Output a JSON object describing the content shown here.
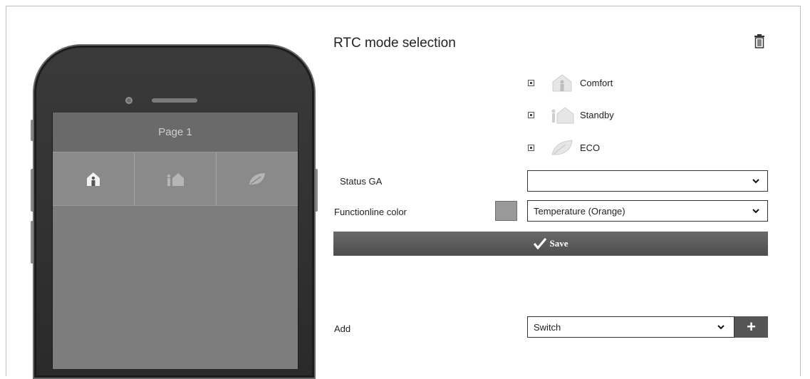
{
  "phone": {
    "page_title": "Page 1",
    "tiles": [
      {
        "icon": "comfort-house-icon"
      },
      {
        "icon": "standby-house-icon"
      },
      {
        "icon": "eco-leaf-icon"
      }
    ]
  },
  "panel": {
    "title": "RTC mode selection",
    "modes": [
      {
        "label": "Comfort",
        "icon": "comfort-house-icon"
      },
      {
        "label": "Standby",
        "icon": "standby-house-icon"
      },
      {
        "label": "ECO",
        "icon": "eco-leaf-icon"
      }
    ],
    "status_ga": {
      "label": "Status GA",
      "value": ""
    },
    "functionline": {
      "label": "Functionline color",
      "value": "Temperature (Orange)",
      "swatch_color": "#9a9a9a"
    },
    "save_label": "Save",
    "add": {
      "label": "Add",
      "value": "Switch",
      "button": "+"
    }
  }
}
